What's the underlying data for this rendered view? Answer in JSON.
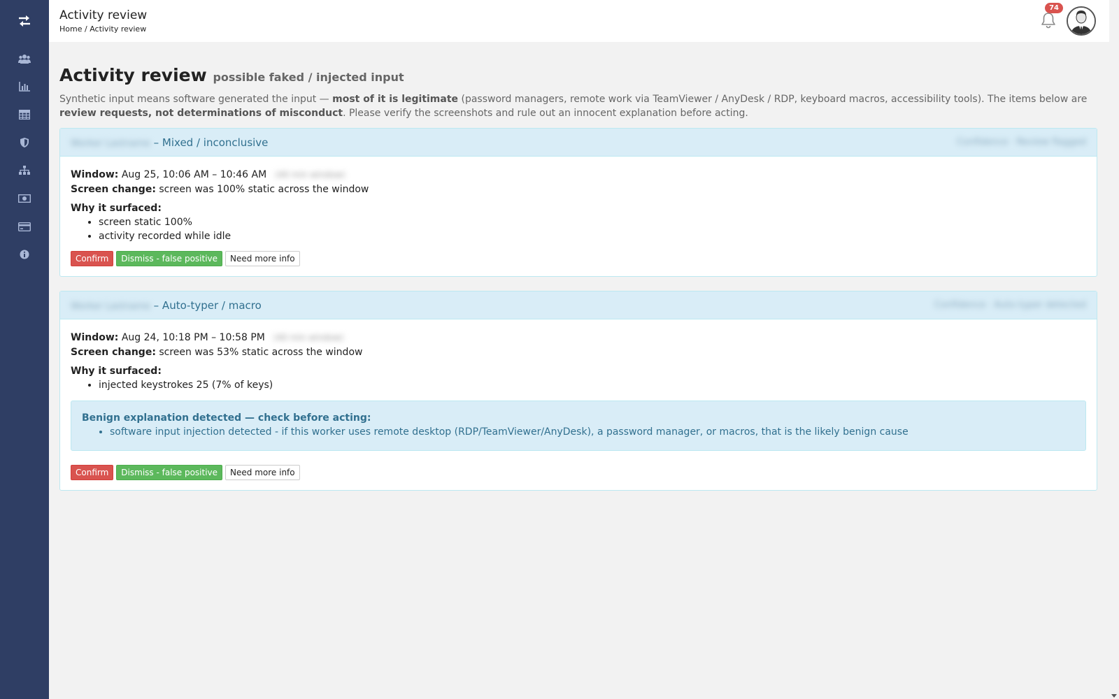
{
  "header": {
    "title": "Activity review",
    "breadcrumb_home": "Home",
    "breadcrumb_sep": " / ",
    "breadcrumb_current": "Activity review",
    "notification_count": "74"
  },
  "sidebar": {
    "items": [
      {
        "icon": "users-icon"
      },
      {
        "icon": "bar-chart-icon"
      },
      {
        "icon": "table-icon"
      },
      {
        "icon": "shield-icon"
      },
      {
        "icon": "sitemap-icon"
      },
      {
        "icon": "money-icon"
      },
      {
        "icon": "credit-card-icon"
      },
      {
        "icon": "info-icon"
      }
    ]
  },
  "page": {
    "title": "Activity review",
    "subtitle": "possible faked / injected input",
    "intro_1": "Synthetic input means software generated the input — ",
    "intro_bold_1": "most of it is legitimate",
    "intro_2": " (password managers, remote work via TeamViewer / AnyDesk / RDP, keyboard macros, accessibility tools). The items below are ",
    "intro_bold_2": "review requests, not determinations of misconduct",
    "intro_3": ". Please verify the screenshots and rule out an innocent explanation before acting."
  },
  "reviews": [
    {
      "worker_blurred": "Worker Lastname",
      "category": " – Mixed / inconclusive",
      "right_blurred": "Confidence · Review flagged",
      "window_label": "Window:",
      "window_value": " Aug 25, 10:06 AM – 10:46 AM",
      "window_extra_blurred": "(40 min window)",
      "screen_label": "Screen change:",
      "screen_value": " screen was 100% static across the window",
      "why_label": "Why it surfaced:",
      "reasons": [
        "screen static 100%",
        "activity recorded while idle"
      ]
    },
    {
      "worker_blurred": "Worker Lastname",
      "category": " – Auto-typer / macro",
      "right_blurred": "Confidence · Auto-typer detected",
      "window_label": "Window:",
      "window_value": " Aug 24, 10:18 PM – 10:58 PM",
      "window_extra_blurred": "(40 min window)",
      "screen_label": "Screen change:",
      "screen_value": " screen was 53% static across the window",
      "why_label": "Why it surfaced:",
      "reasons": [
        "injected keystrokes 25 (7% of keys)"
      ],
      "benign_title": "Benign explanation detected — check before acting:",
      "benign_items": [
        "software input injection detected - if this worker uses remote desktop (RDP/TeamViewer/AnyDesk), a password manager, or macros, that is the likely benign cause"
      ]
    }
  ],
  "actions": {
    "confirm": "Confirm",
    "dismiss": "Dismiss - false positive",
    "more_info": "Need more info"
  },
  "colors": {
    "sidebar": "#2f3e64",
    "panel_heading": "#d9edf7",
    "danger": "#d9534f",
    "success": "#5cb85c",
    "info_text": "#31708f"
  }
}
